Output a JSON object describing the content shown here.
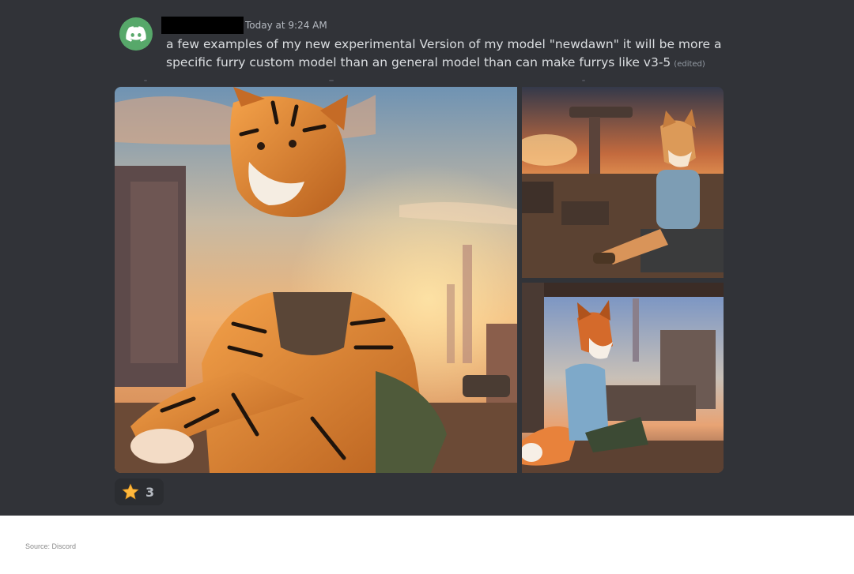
{
  "message": {
    "timestamp": "Today at 9:24 AM",
    "text": "a few examples of my new experimental Version of my model \"newdawn\" it will be more a specific furry custom model than an general model than can make furrys like v3-5",
    "edited_label": "(edited)"
  },
  "attachments": [
    {
      "subject": "tiger-character",
      "scene": "ruined city at sunset"
    },
    {
      "subject": "shiba-character",
      "scene": "ruined city at sunset"
    },
    {
      "subject": "fox-character",
      "scene": "ruined city at sunset"
    }
  ],
  "reaction": {
    "emoji": "star-icon",
    "count": "3"
  },
  "caption": {
    "source": "Source: Discord"
  },
  "colors": {
    "background": "#313338",
    "avatar": "#57a86a",
    "reaction_bg": "#2b2d31",
    "text": "#dbdee1"
  }
}
